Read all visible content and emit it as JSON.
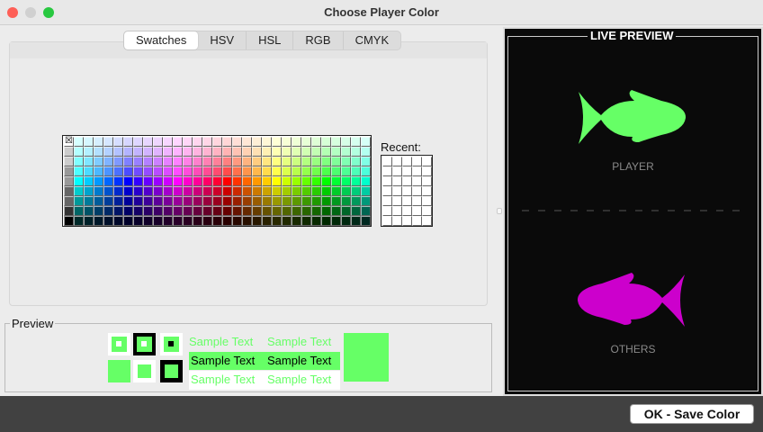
{
  "window": {
    "title": "Choose Player Color"
  },
  "tabs": [
    {
      "label": "Swatches",
      "active": true
    },
    {
      "label": "HSV"
    },
    {
      "label": "HSL"
    },
    {
      "label": "RGB"
    },
    {
      "label": "CMYK"
    }
  ],
  "swatches": {
    "recent_label": "Recent:"
  },
  "preview": {
    "legend": "Preview",
    "sample_text": "Sample Text",
    "selected_color": "#66ff66"
  },
  "live_preview": {
    "title": "LIVE PREVIEW",
    "player_label": "PLAYER",
    "others_label": "OTHERS",
    "player_color": "#66ff66",
    "others_color": "#cc00cc"
  },
  "footer": {
    "ok_label": "OK - Save Color"
  }
}
